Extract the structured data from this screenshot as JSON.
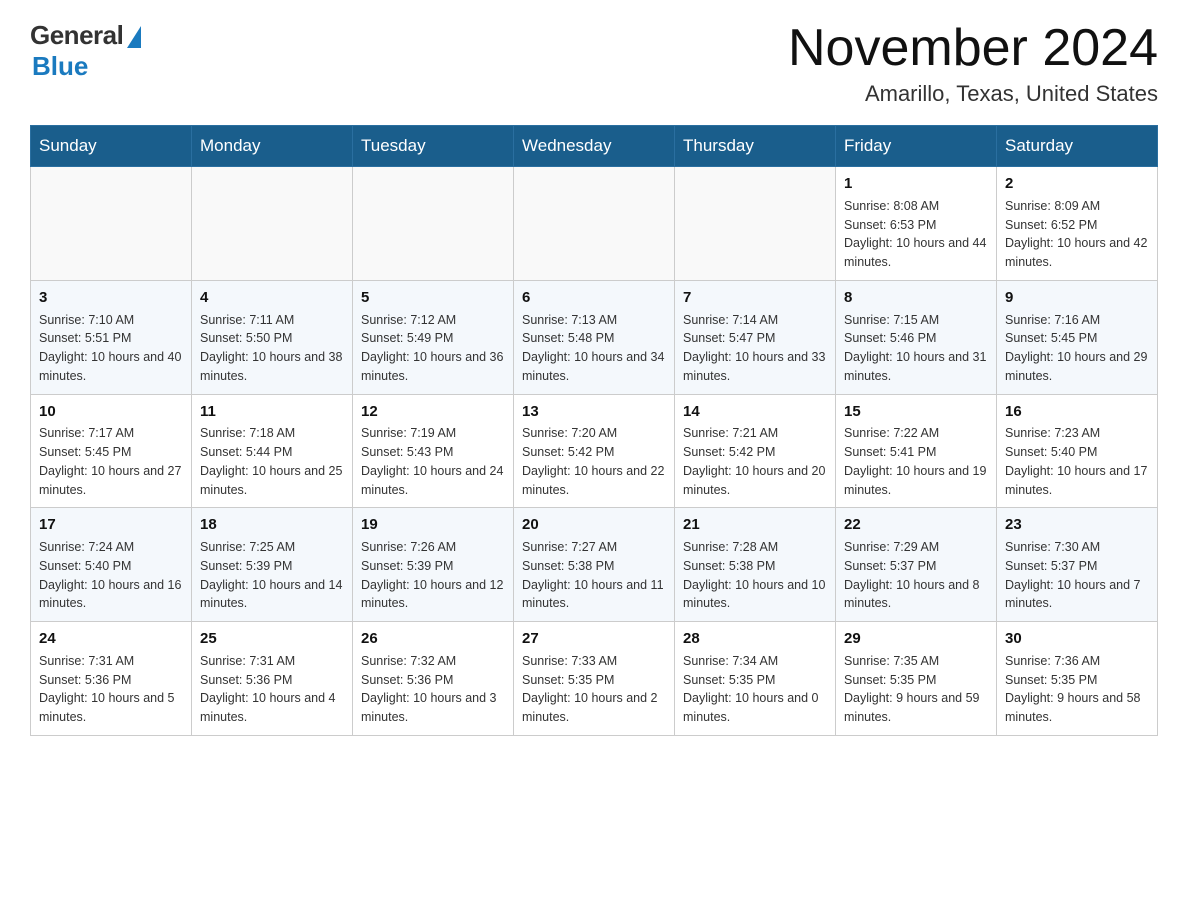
{
  "logo": {
    "general": "General",
    "blue": "Blue"
  },
  "title": "November 2024",
  "location": "Amarillo, Texas, United States",
  "days_of_week": [
    "Sunday",
    "Monday",
    "Tuesday",
    "Wednesday",
    "Thursday",
    "Friday",
    "Saturday"
  ],
  "weeks": [
    [
      {
        "day": "",
        "info": ""
      },
      {
        "day": "",
        "info": ""
      },
      {
        "day": "",
        "info": ""
      },
      {
        "day": "",
        "info": ""
      },
      {
        "day": "",
        "info": ""
      },
      {
        "day": "1",
        "info": "Sunrise: 8:08 AM\nSunset: 6:53 PM\nDaylight: 10 hours and 44 minutes."
      },
      {
        "day": "2",
        "info": "Sunrise: 8:09 AM\nSunset: 6:52 PM\nDaylight: 10 hours and 42 minutes."
      }
    ],
    [
      {
        "day": "3",
        "info": "Sunrise: 7:10 AM\nSunset: 5:51 PM\nDaylight: 10 hours and 40 minutes."
      },
      {
        "day": "4",
        "info": "Sunrise: 7:11 AM\nSunset: 5:50 PM\nDaylight: 10 hours and 38 minutes."
      },
      {
        "day": "5",
        "info": "Sunrise: 7:12 AM\nSunset: 5:49 PM\nDaylight: 10 hours and 36 minutes."
      },
      {
        "day": "6",
        "info": "Sunrise: 7:13 AM\nSunset: 5:48 PM\nDaylight: 10 hours and 34 minutes."
      },
      {
        "day": "7",
        "info": "Sunrise: 7:14 AM\nSunset: 5:47 PM\nDaylight: 10 hours and 33 minutes."
      },
      {
        "day": "8",
        "info": "Sunrise: 7:15 AM\nSunset: 5:46 PM\nDaylight: 10 hours and 31 minutes."
      },
      {
        "day": "9",
        "info": "Sunrise: 7:16 AM\nSunset: 5:45 PM\nDaylight: 10 hours and 29 minutes."
      }
    ],
    [
      {
        "day": "10",
        "info": "Sunrise: 7:17 AM\nSunset: 5:45 PM\nDaylight: 10 hours and 27 minutes."
      },
      {
        "day": "11",
        "info": "Sunrise: 7:18 AM\nSunset: 5:44 PM\nDaylight: 10 hours and 25 minutes."
      },
      {
        "day": "12",
        "info": "Sunrise: 7:19 AM\nSunset: 5:43 PM\nDaylight: 10 hours and 24 minutes."
      },
      {
        "day": "13",
        "info": "Sunrise: 7:20 AM\nSunset: 5:42 PM\nDaylight: 10 hours and 22 minutes."
      },
      {
        "day": "14",
        "info": "Sunrise: 7:21 AM\nSunset: 5:42 PM\nDaylight: 10 hours and 20 minutes."
      },
      {
        "day": "15",
        "info": "Sunrise: 7:22 AM\nSunset: 5:41 PM\nDaylight: 10 hours and 19 minutes."
      },
      {
        "day": "16",
        "info": "Sunrise: 7:23 AM\nSunset: 5:40 PM\nDaylight: 10 hours and 17 minutes."
      }
    ],
    [
      {
        "day": "17",
        "info": "Sunrise: 7:24 AM\nSunset: 5:40 PM\nDaylight: 10 hours and 16 minutes."
      },
      {
        "day": "18",
        "info": "Sunrise: 7:25 AM\nSunset: 5:39 PM\nDaylight: 10 hours and 14 minutes."
      },
      {
        "day": "19",
        "info": "Sunrise: 7:26 AM\nSunset: 5:39 PM\nDaylight: 10 hours and 12 minutes."
      },
      {
        "day": "20",
        "info": "Sunrise: 7:27 AM\nSunset: 5:38 PM\nDaylight: 10 hours and 11 minutes."
      },
      {
        "day": "21",
        "info": "Sunrise: 7:28 AM\nSunset: 5:38 PM\nDaylight: 10 hours and 10 minutes."
      },
      {
        "day": "22",
        "info": "Sunrise: 7:29 AM\nSunset: 5:37 PM\nDaylight: 10 hours and 8 minutes."
      },
      {
        "day": "23",
        "info": "Sunrise: 7:30 AM\nSunset: 5:37 PM\nDaylight: 10 hours and 7 minutes."
      }
    ],
    [
      {
        "day": "24",
        "info": "Sunrise: 7:31 AM\nSunset: 5:36 PM\nDaylight: 10 hours and 5 minutes."
      },
      {
        "day": "25",
        "info": "Sunrise: 7:31 AM\nSunset: 5:36 PM\nDaylight: 10 hours and 4 minutes."
      },
      {
        "day": "26",
        "info": "Sunrise: 7:32 AM\nSunset: 5:36 PM\nDaylight: 10 hours and 3 minutes."
      },
      {
        "day": "27",
        "info": "Sunrise: 7:33 AM\nSunset: 5:35 PM\nDaylight: 10 hours and 2 minutes."
      },
      {
        "day": "28",
        "info": "Sunrise: 7:34 AM\nSunset: 5:35 PM\nDaylight: 10 hours and 0 minutes."
      },
      {
        "day": "29",
        "info": "Sunrise: 7:35 AM\nSunset: 5:35 PM\nDaylight: 9 hours and 59 minutes."
      },
      {
        "day": "30",
        "info": "Sunrise: 7:36 AM\nSunset: 5:35 PM\nDaylight: 9 hours and 58 minutes."
      }
    ]
  ]
}
